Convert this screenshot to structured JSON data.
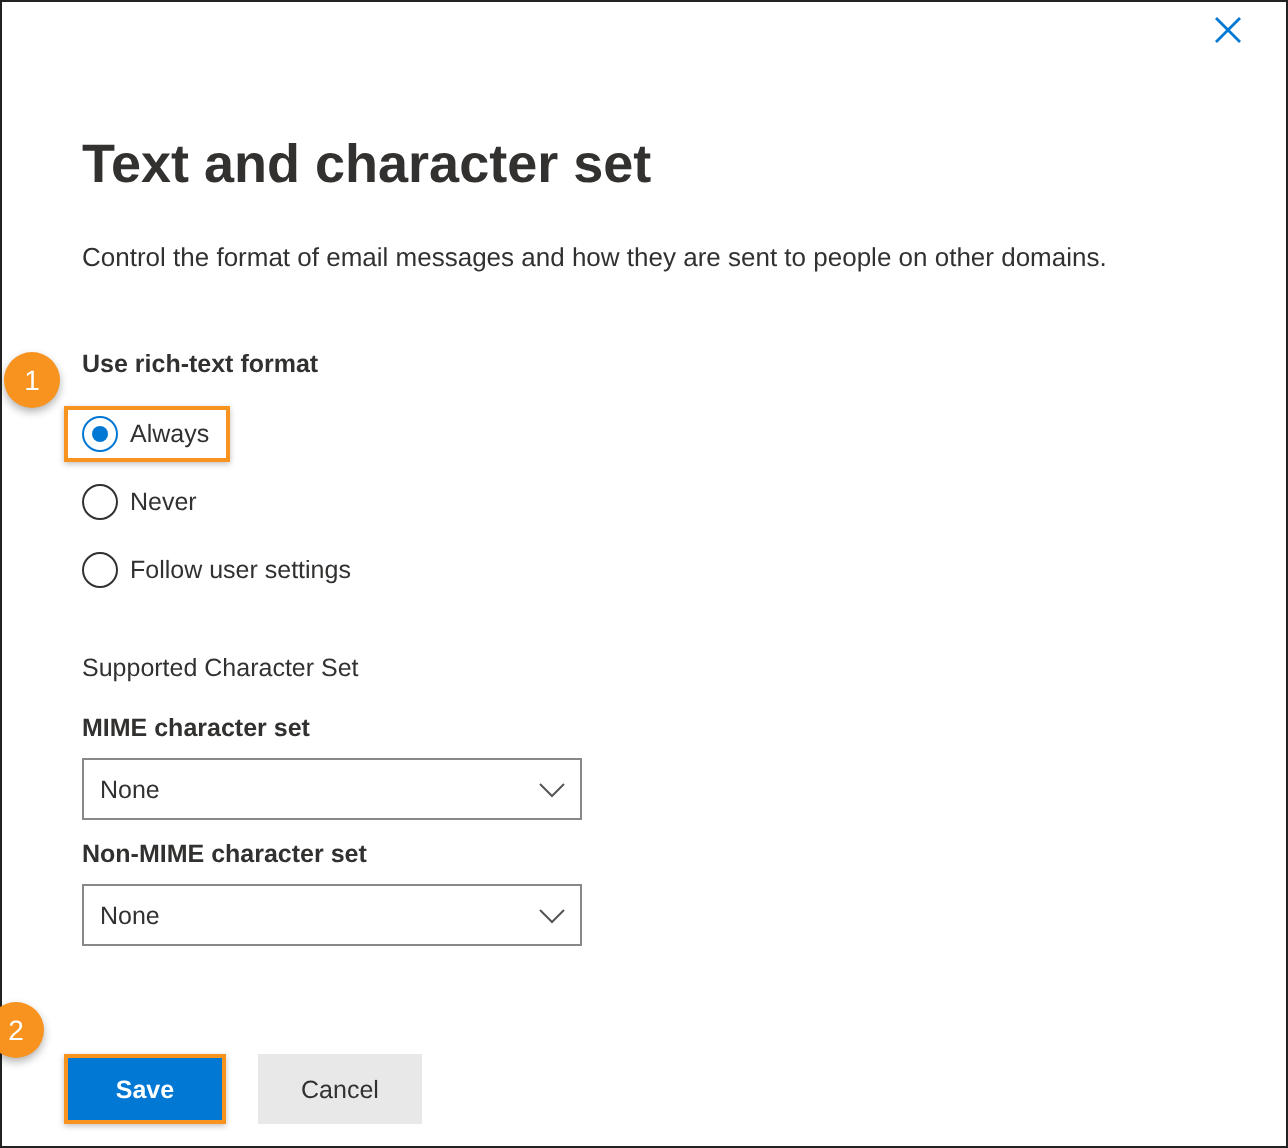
{
  "dialog": {
    "title": "Text and character set",
    "description": "Control the format of email messages and how they are sent to people on other domains."
  },
  "rich_text": {
    "label": "Use rich-text format",
    "options": [
      {
        "label": "Always",
        "selected": true,
        "highlighted": true,
        "callout": "1"
      },
      {
        "label": "Never",
        "selected": false,
        "highlighted": false
      },
      {
        "label": "Follow user settings",
        "selected": false,
        "highlighted": false
      }
    ]
  },
  "character_set": {
    "heading": "Supported Character Set",
    "fields": [
      {
        "label": "MIME character set",
        "value": "None"
      },
      {
        "label": "Non-MIME character set",
        "value": "None"
      }
    ]
  },
  "buttons": [
    {
      "label": "Save",
      "kind": "primary",
      "highlighted": true,
      "callout": "2"
    },
    {
      "label": "Cancel",
      "kind": "secondary",
      "highlighted": false
    }
  ]
}
